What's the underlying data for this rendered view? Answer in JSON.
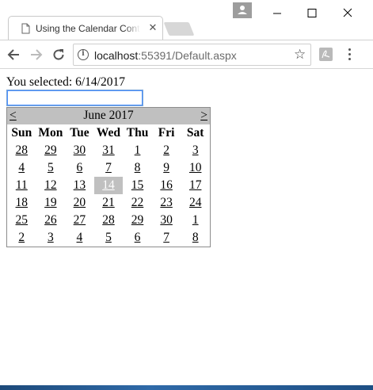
{
  "browser": {
    "tab_title": "Using the Calendar Control",
    "tab_close": "✕",
    "url_host": "localhost",
    "url_path": ":55391/Default.aspx",
    "star": "☆"
  },
  "page": {
    "selected_text": "You selected: 6/14/2017",
    "input_value": ""
  },
  "calendar": {
    "prev": "<",
    "next": ">",
    "title": "June 2017",
    "weekdays": [
      "Sun",
      "Mon",
      "Tue",
      "Wed",
      "Thu",
      "Fri",
      "Sat"
    ],
    "weeks": [
      [
        "28",
        "29",
        "30",
        "31",
        "1",
        "2",
        "3"
      ],
      [
        "4",
        "5",
        "6",
        "7",
        "8",
        "9",
        "10"
      ],
      [
        "11",
        "12",
        "13",
        "14",
        "15",
        "16",
        "17"
      ],
      [
        "18",
        "19",
        "20",
        "21",
        "22",
        "23",
        "24"
      ],
      [
        "25",
        "26",
        "27",
        "28",
        "29",
        "30",
        "1"
      ],
      [
        "2",
        "3",
        "4",
        "5",
        "6",
        "7",
        "8"
      ]
    ],
    "selected_day": "14",
    "selected_color": "#c0c0c0"
  }
}
